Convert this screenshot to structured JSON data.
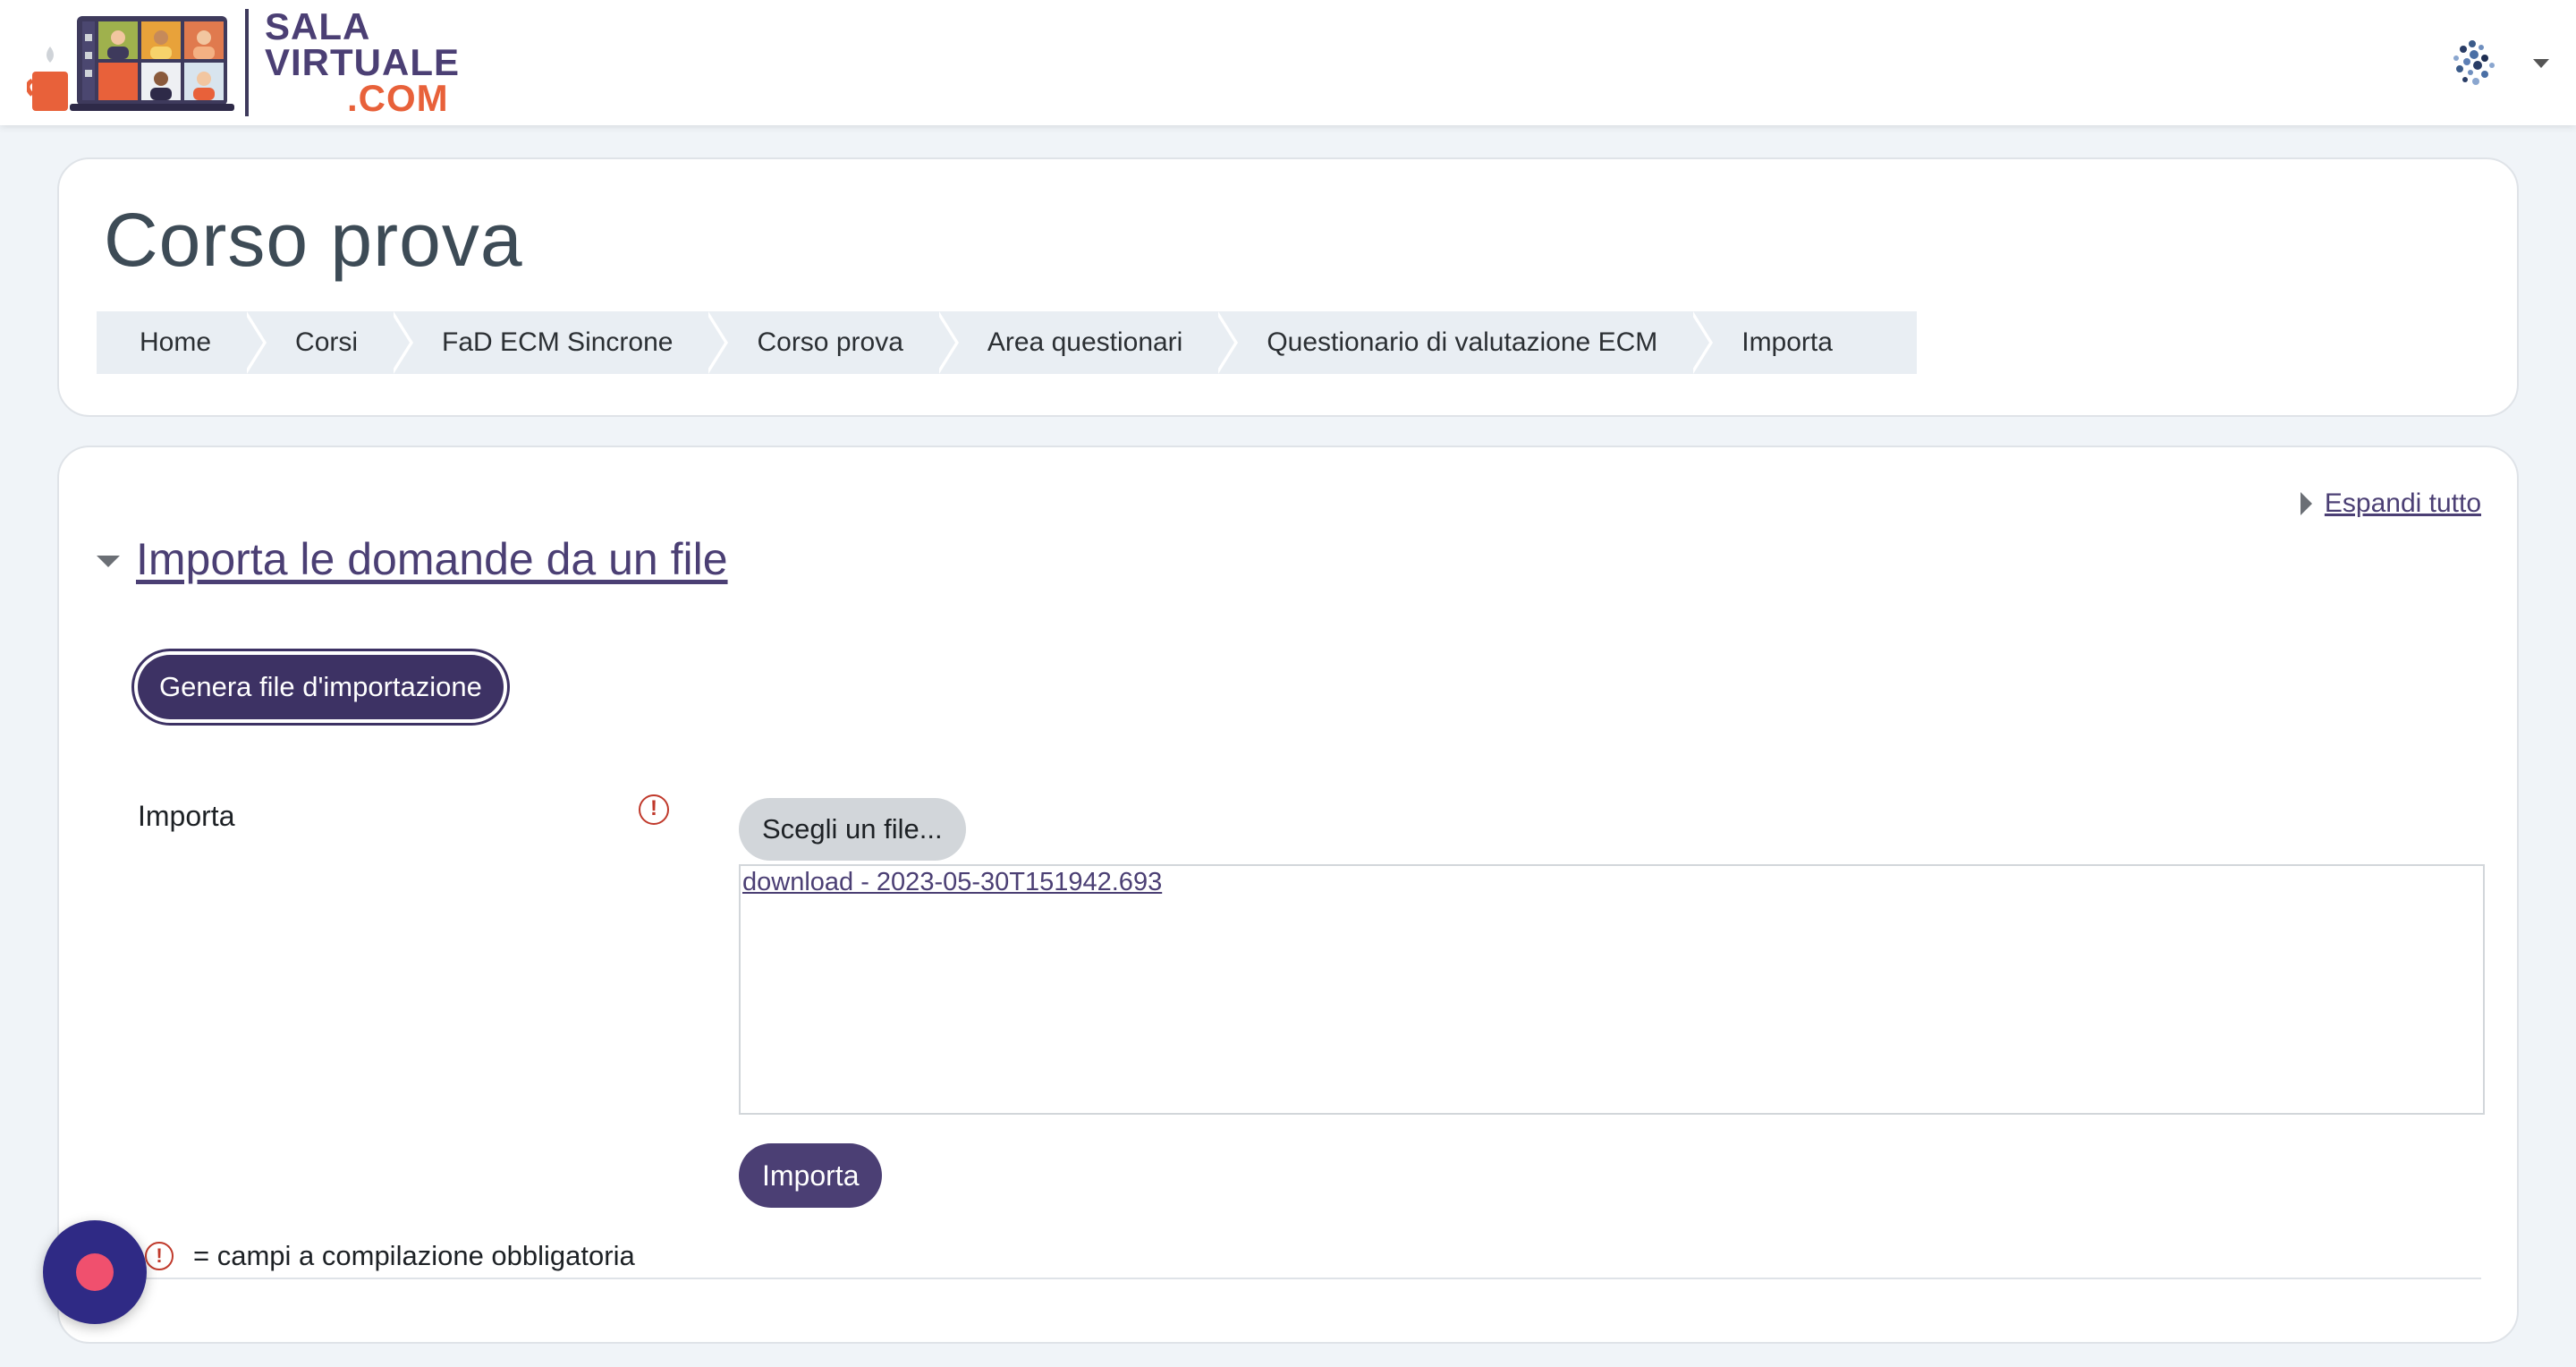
{
  "navbar": {
    "brand": {
      "line1": "SALA",
      "line2": "VIRTUALE",
      "line3": ".COM"
    },
    "avatar_icon": "user-avatar-icon",
    "menu_icon": "chevron-down-icon"
  },
  "header": {
    "title": "Corso prova",
    "breadcrumb": [
      "Home",
      "Corsi",
      "FaD ECM Sincrone",
      "Corso prova",
      "Area questionari",
      "Questionario di valutazione ECM",
      "Importa"
    ]
  },
  "main": {
    "expand_all": "Espandi tutto",
    "section_title": "Importa le domande da un file",
    "generate_button": "Genera file d'importazione",
    "import_label": "Importa",
    "required_icon": "!",
    "choose_file_button": "Scegli un file...",
    "uploaded_file": "download - 2023-05-30T151942.693",
    "submit_button": "Importa",
    "required_note": "= campi a compilazione obbligatoria"
  },
  "colors": {
    "brand_purple": "#4b3f74",
    "brand_orange": "#e8613a",
    "required_red": "#c0392b",
    "fab_blue": "#2f2a85",
    "fab_dot": "#f0506e"
  }
}
